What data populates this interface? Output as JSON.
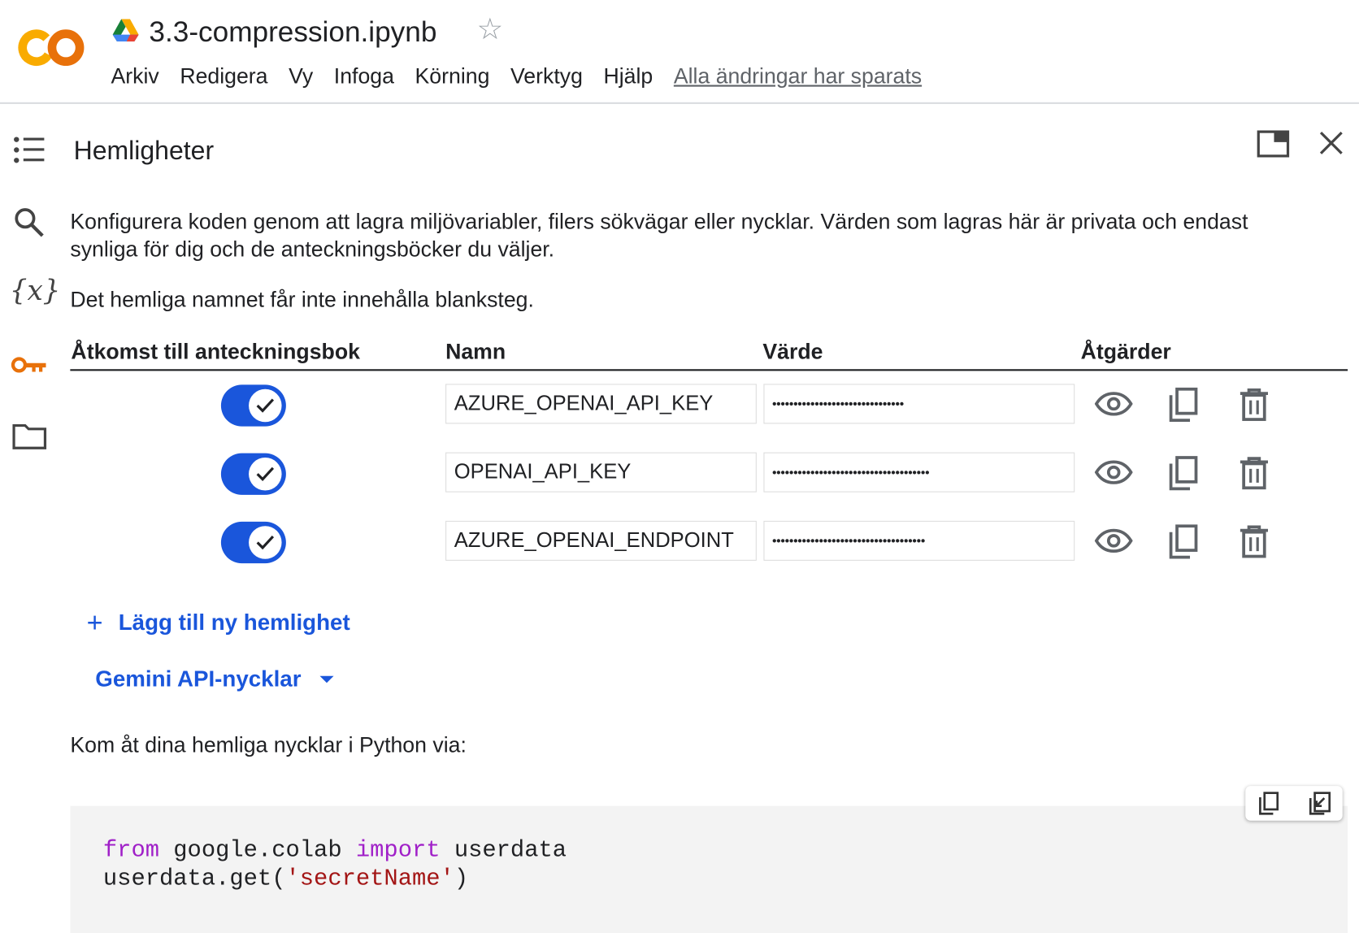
{
  "header": {
    "title": "3.3-compression.ipynb",
    "menu": [
      "Arkiv",
      "Redigera",
      "Vy",
      "Infoga",
      "Körning",
      "Verktyg",
      "Hjälp"
    ],
    "saved_status": "Alla ändringar har sparats"
  },
  "panel": {
    "title": "Hemligheter",
    "description": "Konfigurera koden genom att lagra miljövariabler, filers sökvägar eller nycklar. Värden som lagras här är privata och endast synliga för dig och de anteckningsböcker du väljer.",
    "note": "Det hemliga namnet får inte innehålla blanksteg.",
    "columns": [
      "Åtkomst till anteckningsbok",
      "Namn",
      "Värde",
      "Åtgärder"
    ],
    "secrets": [
      {
        "name": "AZURE_OPENAI_API_KEY",
        "value": "•••••••••••••••••••••••••••••••",
        "access": true
      },
      {
        "name": "OPENAI_API_KEY",
        "value": "•••••••••••••••••••••••••••••••••••••",
        "access": true
      },
      {
        "name": "AZURE_OPENAI_ENDPOINT",
        "value": "••••••••••••••••••••••••••••••••••••",
        "access": true
      }
    ],
    "add_label": "Lägg till ny hemlighet",
    "gemini_label": "Gemini API-nycklar",
    "access_text": "Kom åt dina hemliga nycklar i Python via:",
    "code": {
      "kw1": "from",
      "mod": " google.colab ",
      "kw2": "import",
      "rest1": " userdata",
      "line2a": "userdata.get(",
      "line2s": "'secretName'",
      "line2b": ")"
    }
  },
  "colors": {
    "accent": "#1a56db",
    "logo_orange": "#e8710a",
    "logo_yellow": "#f9ab00"
  }
}
